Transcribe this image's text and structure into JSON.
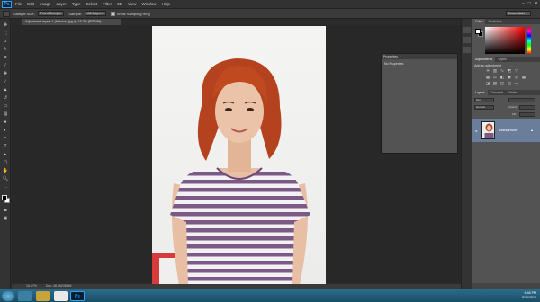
{
  "menu": {
    "logo": "Ps",
    "items": [
      "File",
      "Edit",
      "Image",
      "Layer",
      "Type",
      "Select",
      "Filter",
      "3D",
      "View",
      "Window",
      "Help"
    ]
  },
  "options": {
    "sample_size_label": "Sample Size:",
    "sample_size_value": "Point Sample",
    "sample_label": "Sample:",
    "sample_value": "All Layers",
    "show_ring_label": "Show Sampling Ring",
    "workspace": "Essentials"
  },
  "document": {
    "tab_title": "Adjustment layers 1 (Mission).jpg @ 16.7% (RGB/8*) ×",
    "zoom": "16.67%",
    "doc_info": "Doc: 38.6M/38.6M"
  },
  "properties": {
    "title": "Properties",
    "body": "No Properties"
  },
  "color_panel": {
    "tabs": [
      "Color",
      "Swatches"
    ]
  },
  "adjustments": {
    "tabs": [
      "Adjustments",
      "Styles"
    ],
    "add_label": "Add an adjustment"
  },
  "layers": {
    "tabs": [
      "Layers",
      "Channels",
      "Paths"
    ],
    "kind_filter": "Kind",
    "blend_mode": "Normal",
    "opacity_label": "Opacity:",
    "fill_label": "Fill:",
    "layer_name": "Background"
  },
  "taskbar": {
    "time": "6:48 PM",
    "date": "5/30/2016"
  },
  "colors": {
    "accent": "#2fa3f7",
    "layer_selected": "#6a7e9b",
    "hair": "#b4421e",
    "stripe": "#7b5a86"
  }
}
